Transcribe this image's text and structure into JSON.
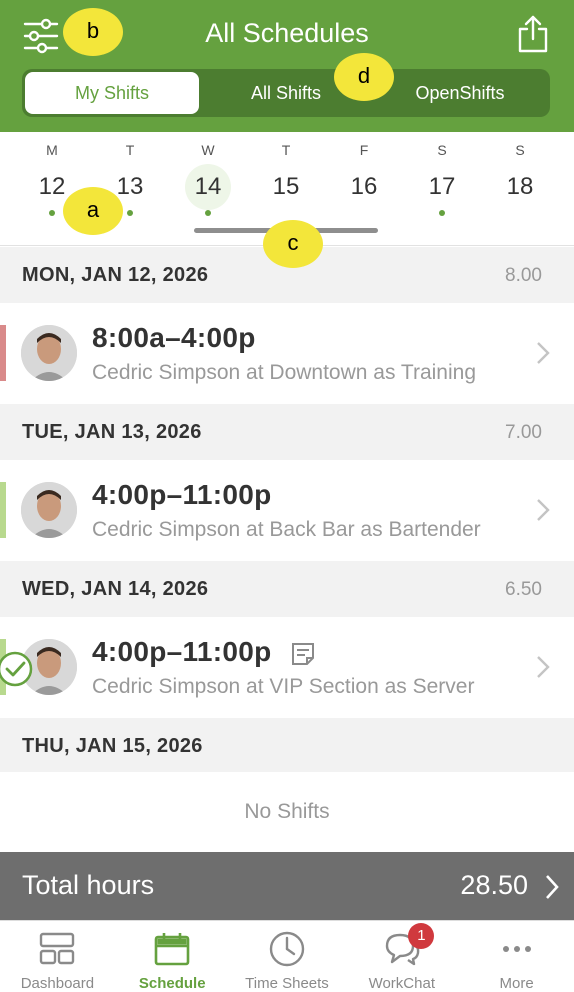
{
  "header": {
    "title": "All Schedules",
    "filter_icon": "sliders-icon",
    "share_icon": "share-icon",
    "segments": [
      {
        "label": "My Shifts",
        "active": true
      },
      {
        "label": "All Shifts",
        "active": false
      },
      {
        "label": "OpenShifts",
        "active": false
      }
    ]
  },
  "week": {
    "days": [
      {
        "letter": "M",
        "num": "12",
        "has_shift": true,
        "selected": false
      },
      {
        "letter": "T",
        "num": "13",
        "has_shift": true,
        "selected": false
      },
      {
        "letter": "W",
        "num": "14",
        "has_shift": true,
        "selected": true
      },
      {
        "letter": "T",
        "num": "15",
        "has_shift": false,
        "selected": false
      },
      {
        "letter": "F",
        "num": "16",
        "has_shift": false,
        "selected": false
      },
      {
        "letter": "S",
        "num": "17",
        "has_shift": true,
        "selected": false
      },
      {
        "letter": "S",
        "num": "18",
        "has_shift": false,
        "selected": false
      }
    ]
  },
  "sections": [
    {
      "date": "MON, JAN 12, 2026",
      "hours": "8.00"
    },
    {
      "date": "TUE, JAN 13, 2026",
      "hours": "7.00"
    },
    {
      "date": "WED, JAN 14, 2026",
      "hours": "6.50"
    },
    {
      "date": "THU, JAN 15, 2026",
      "hours": ""
    }
  ],
  "shifts": [
    {
      "time": "8:00a–4:00p",
      "description": "Cedric Simpson at Downtown as Training",
      "status_color": "#d98a8a"
    },
    {
      "time": "4:00p–11:00p",
      "description": "Cedric Simpson at Back Bar as Bartender",
      "status_color": "#b8d98e"
    },
    {
      "time": "4:00p–11:00p",
      "description": "Cedric Simpson at VIP Section as Server",
      "status_color": "#b8d98e"
    }
  ],
  "empty_text": "No Shifts",
  "total": {
    "label": "Total hours",
    "value": "28.50"
  },
  "tabs": [
    {
      "label": "Dashboard",
      "icon": "dashboard-icon"
    },
    {
      "label": "Schedule",
      "icon": "calendar-icon",
      "active": true
    },
    {
      "label": "Time Sheets",
      "icon": "clock-icon"
    },
    {
      "label": "WorkChat",
      "icon": "chat-icon",
      "badge": "1"
    },
    {
      "label": "More",
      "icon": "more-icon"
    }
  ],
  "markers": [
    "a",
    "b",
    "c",
    "d"
  ],
  "colors": {
    "brand_green": "#65a13f",
    "badge_red": "#d0393e",
    "marker_yellow": "#f3e63a"
  }
}
